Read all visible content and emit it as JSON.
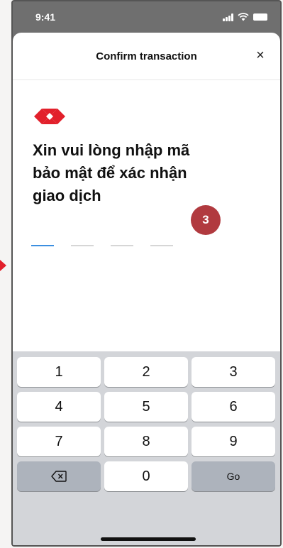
{
  "status_bar": {
    "time": "9:41"
  },
  "header": {
    "title": "Confirm transaction",
    "close_symbol": "×"
  },
  "prompt": {
    "text": "Xin vui lòng nhập mã bảo mật để xác nhận giao dịch"
  },
  "step_badge": "3",
  "pin": {
    "length": 4,
    "filled": 0
  },
  "keypad": {
    "keys": [
      "1",
      "2",
      "3",
      "4",
      "5",
      "6",
      "7",
      "8",
      "9"
    ],
    "zero": "0",
    "go_label": "Go",
    "backspace_icon": "backspace-icon"
  },
  "colors": {
    "brand_red": "#e2202b",
    "badge": "#b13a3f",
    "active_slot": "#3c8fe0"
  }
}
